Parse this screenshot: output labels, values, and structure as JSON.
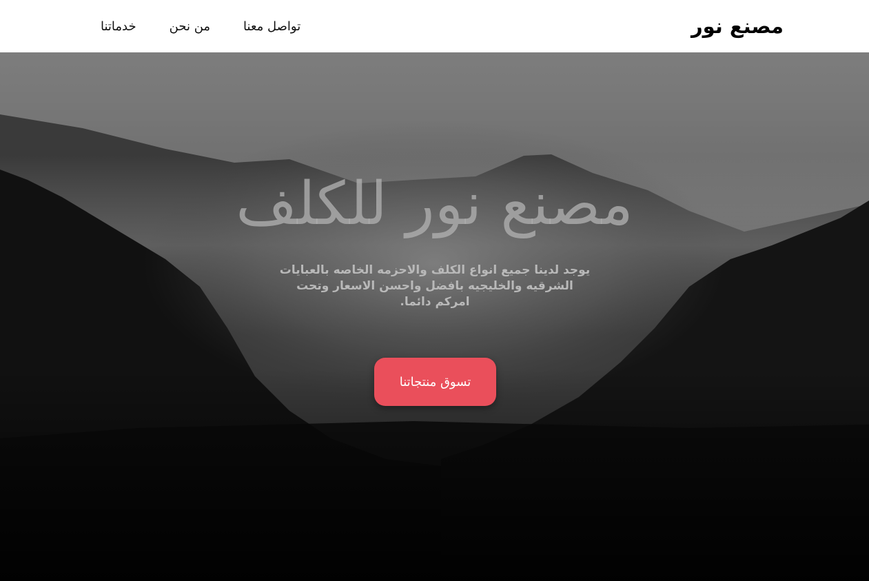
{
  "nav": {
    "brand": "مصنع نور",
    "links": [
      {
        "label": "خدماتنا"
      },
      {
        "label": "من نحن"
      },
      {
        "label": "تواصل معنا"
      }
    ]
  },
  "hero": {
    "title": "مصنع نور للكلف",
    "description": "يوجد لدينا جميع انواع الكلف والاحزمه الخاصه بالعبايات الشرقيه والخليجيه بافضل واحسن الاسعار وتحت امركم دائما.",
    "cta_label": "تسوق منتجاتنا"
  },
  "colors": {
    "nav_background": "#ffffff",
    "cta_background": "#ea4f5b",
    "title_color": "#afafaf",
    "description_color": "#b9b9b9"
  }
}
